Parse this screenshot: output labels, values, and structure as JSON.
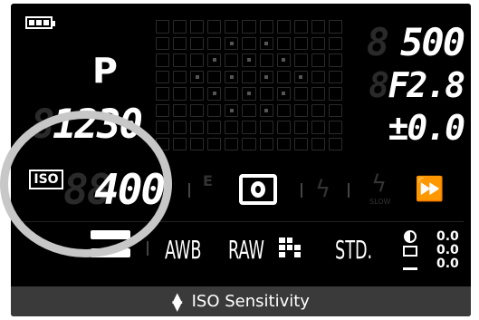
{
  "mode": "P",
  "shutter": "500",
  "shutter_ghost": "8",
  "aperture": "F2.8",
  "aperture_ghost": "8",
  "exposure_comp": "±0.0",
  "shots_remaining": "1230",
  "shots_ghost": "8",
  "iso_badge": "ISO",
  "iso_value": "400",
  "iso_ghost": "88",
  "af_mode_label": "E",
  "flash_slow_label": "SLOW",
  "bottom_row": {
    "awb": "AWB",
    "raw": "RAW",
    "picture_style": "STD."
  },
  "adjustments": [
    "0.0",
    "0.0",
    "0.0"
  ],
  "status_bar": {
    "label": "ISO Sensitivity",
    "icon": "up-down-arrows-icon"
  },
  "colors": {
    "screen_bg": "#000000",
    "highlight_ring": "#c7c7c7",
    "status_bar_bg": "#3a3a3a"
  }
}
